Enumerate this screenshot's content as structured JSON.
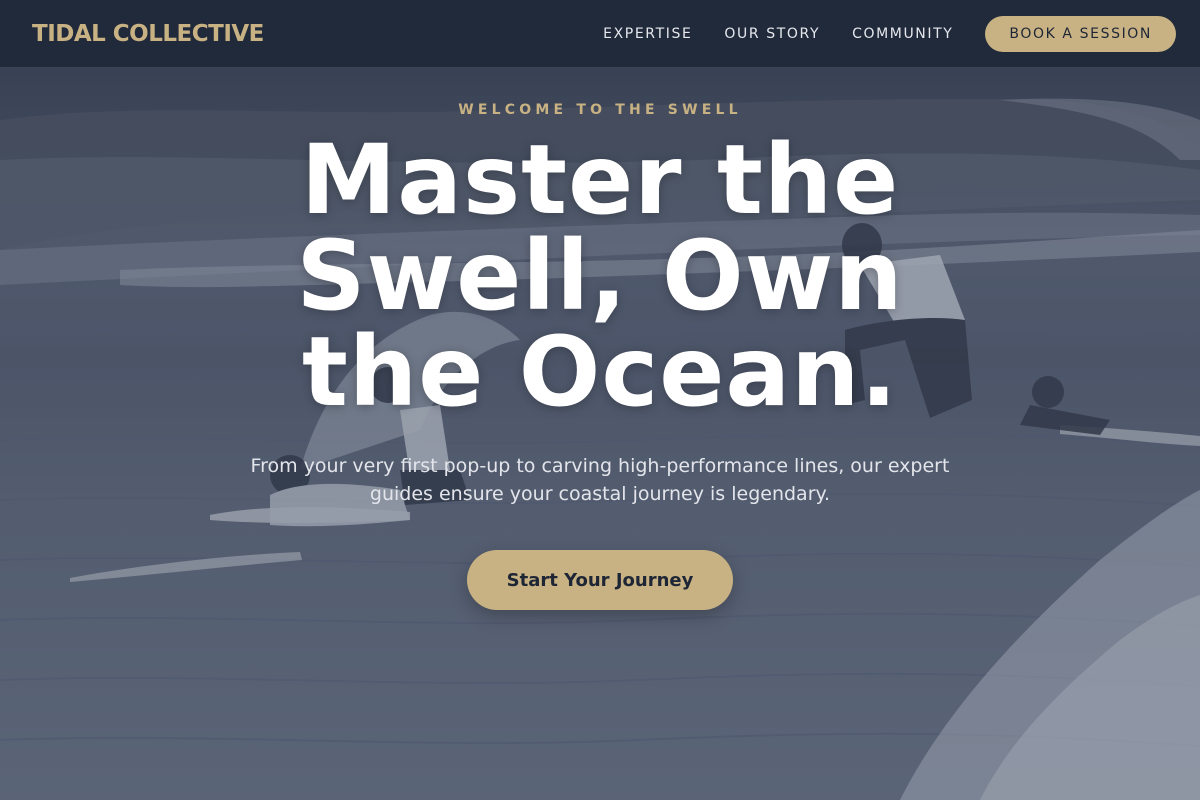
{
  "brand": {
    "name": "TIDAL COLLECTIVE"
  },
  "nav": {
    "links": [
      {
        "label": "EXPERTISE"
      },
      {
        "label": "OUR STORY"
      },
      {
        "label": "COMMUNITY"
      }
    ],
    "cta_label": "BOOK A SESSION"
  },
  "hero": {
    "eyebrow": "WELCOME TO THE SWELL",
    "headline": "Master the Swell, Own the Ocean.",
    "subtext": "From your very first pop-up to carving high-performance lines, our expert guides ensure your coastal journey is legendary.",
    "cta_label": "Start Your Journey",
    "background_image": "surfers-paddling-wave-photo"
  },
  "colors": {
    "nav_bg": "#212a3b",
    "accent_gold": "#c8b283",
    "headline": "#ffffff",
    "overlay": "#3a4458"
  }
}
